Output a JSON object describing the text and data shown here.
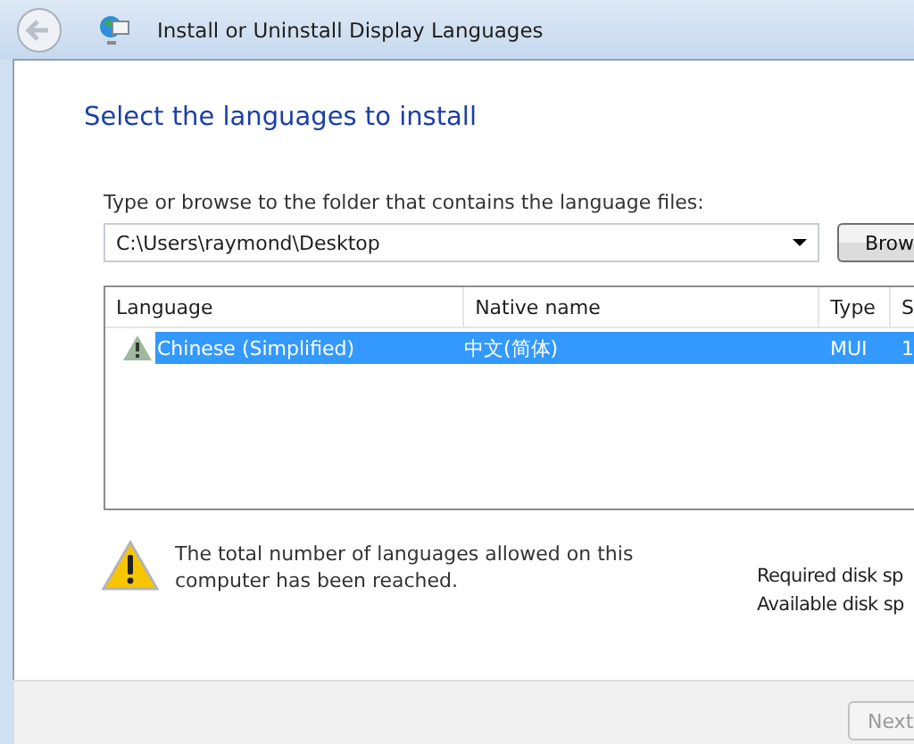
{
  "window": {
    "title": "Install or Uninstall Display Languages"
  },
  "heading": "Select the languages to install",
  "folder": {
    "label": "Type or browse to the folder that contains the language files:",
    "value": "C:\\Users\\raymond\\Desktop",
    "browse_button": "Brow"
  },
  "table": {
    "columns": [
      "Language",
      "Native name",
      "Type",
      "S"
    ],
    "rows": [
      {
        "cells": [
          "Chinese (Simplified)",
          "中文(简体)",
          "MUI",
          "1"
        ],
        "selected": true,
        "warning": true
      }
    ]
  },
  "warning_message": "The total number of languages allowed on this computer has been reached.",
  "disk_info": [
    "Required disk sp",
    "Available disk sp"
  ],
  "buttons": [
    {
      "label": "Next",
      "disabled": true
    }
  ]
}
